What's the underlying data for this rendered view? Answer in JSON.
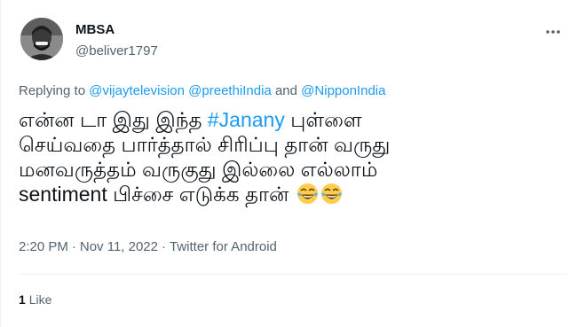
{
  "tweet": {
    "author": {
      "display_name": "MBSA",
      "handle": "@beliver1797"
    },
    "replying": {
      "prefix": "Replying to ",
      "mention_1": "@vijaytelevision",
      "mention_2": "@preethiIndia",
      "conjunction": " and ",
      "mention_3": "@NipponIndia"
    },
    "body": {
      "line1_text": "என்ன டா இது இந்த ",
      "hashtag": "#Janany",
      "line1_tail": " புள்ளை",
      "line2": "செய்வதை பார்த்தால் சிரிப்பு தான் வருது",
      "line3": "மனவருத்தம் வருகுது இல்லை எல்லாம்",
      "line4": "sentiment பிச்சை எடுக்க தான் ",
      "emojis": [
        "face-with-tears-of-joy-icon",
        "face-with-tears-of-joy-icon"
      ]
    },
    "meta": {
      "time": "2:20 PM",
      "separator": "·",
      "date": "Nov 11, 2022",
      "source": "Twitter for Android"
    },
    "stats": {
      "like_count": "1",
      "like_label": "Like"
    }
  },
  "colors": {
    "link": "#1d9bf0",
    "secondary_text": "#536471",
    "primary_text": "#0f1419",
    "divider": "#eff3f4"
  }
}
